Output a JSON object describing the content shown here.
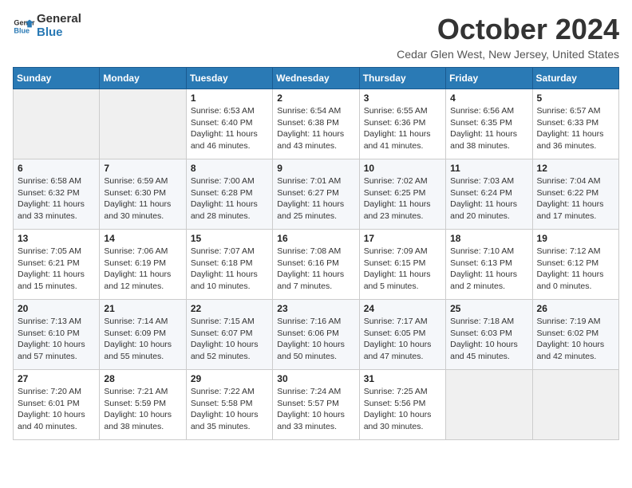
{
  "logo": {
    "line1": "General",
    "line2": "Blue"
  },
  "title": "October 2024",
  "subtitle": "Cedar Glen West, New Jersey, United States",
  "days_header": [
    "Sunday",
    "Monday",
    "Tuesday",
    "Wednesday",
    "Thursday",
    "Friday",
    "Saturday"
  ],
  "weeks": [
    [
      {
        "day": "",
        "info": ""
      },
      {
        "day": "",
        "info": ""
      },
      {
        "day": "1",
        "info": "Sunrise: 6:53 AM\nSunset: 6:40 PM\nDaylight: 11 hours\nand 46 minutes."
      },
      {
        "day": "2",
        "info": "Sunrise: 6:54 AM\nSunset: 6:38 PM\nDaylight: 11 hours\nand 43 minutes."
      },
      {
        "day": "3",
        "info": "Sunrise: 6:55 AM\nSunset: 6:36 PM\nDaylight: 11 hours\nand 41 minutes."
      },
      {
        "day": "4",
        "info": "Sunrise: 6:56 AM\nSunset: 6:35 PM\nDaylight: 11 hours\nand 38 minutes."
      },
      {
        "day": "5",
        "info": "Sunrise: 6:57 AM\nSunset: 6:33 PM\nDaylight: 11 hours\nand 36 minutes."
      }
    ],
    [
      {
        "day": "6",
        "info": "Sunrise: 6:58 AM\nSunset: 6:32 PM\nDaylight: 11 hours\nand 33 minutes."
      },
      {
        "day": "7",
        "info": "Sunrise: 6:59 AM\nSunset: 6:30 PM\nDaylight: 11 hours\nand 30 minutes."
      },
      {
        "day": "8",
        "info": "Sunrise: 7:00 AM\nSunset: 6:28 PM\nDaylight: 11 hours\nand 28 minutes."
      },
      {
        "day": "9",
        "info": "Sunrise: 7:01 AM\nSunset: 6:27 PM\nDaylight: 11 hours\nand 25 minutes."
      },
      {
        "day": "10",
        "info": "Sunrise: 7:02 AM\nSunset: 6:25 PM\nDaylight: 11 hours\nand 23 minutes."
      },
      {
        "day": "11",
        "info": "Sunrise: 7:03 AM\nSunset: 6:24 PM\nDaylight: 11 hours\nand 20 minutes."
      },
      {
        "day": "12",
        "info": "Sunrise: 7:04 AM\nSunset: 6:22 PM\nDaylight: 11 hours\nand 17 minutes."
      }
    ],
    [
      {
        "day": "13",
        "info": "Sunrise: 7:05 AM\nSunset: 6:21 PM\nDaylight: 11 hours\nand 15 minutes."
      },
      {
        "day": "14",
        "info": "Sunrise: 7:06 AM\nSunset: 6:19 PM\nDaylight: 11 hours\nand 12 minutes."
      },
      {
        "day": "15",
        "info": "Sunrise: 7:07 AM\nSunset: 6:18 PM\nDaylight: 11 hours\nand 10 minutes."
      },
      {
        "day": "16",
        "info": "Sunrise: 7:08 AM\nSunset: 6:16 PM\nDaylight: 11 hours\nand 7 minutes."
      },
      {
        "day": "17",
        "info": "Sunrise: 7:09 AM\nSunset: 6:15 PM\nDaylight: 11 hours\nand 5 minutes."
      },
      {
        "day": "18",
        "info": "Sunrise: 7:10 AM\nSunset: 6:13 PM\nDaylight: 11 hours\nand 2 minutes."
      },
      {
        "day": "19",
        "info": "Sunrise: 7:12 AM\nSunset: 6:12 PM\nDaylight: 11 hours\nand 0 minutes."
      }
    ],
    [
      {
        "day": "20",
        "info": "Sunrise: 7:13 AM\nSunset: 6:10 PM\nDaylight: 10 hours\nand 57 minutes."
      },
      {
        "day": "21",
        "info": "Sunrise: 7:14 AM\nSunset: 6:09 PM\nDaylight: 10 hours\nand 55 minutes."
      },
      {
        "day": "22",
        "info": "Sunrise: 7:15 AM\nSunset: 6:07 PM\nDaylight: 10 hours\nand 52 minutes."
      },
      {
        "day": "23",
        "info": "Sunrise: 7:16 AM\nSunset: 6:06 PM\nDaylight: 10 hours\nand 50 minutes."
      },
      {
        "day": "24",
        "info": "Sunrise: 7:17 AM\nSunset: 6:05 PM\nDaylight: 10 hours\nand 47 minutes."
      },
      {
        "day": "25",
        "info": "Sunrise: 7:18 AM\nSunset: 6:03 PM\nDaylight: 10 hours\nand 45 minutes."
      },
      {
        "day": "26",
        "info": "Sunrise: 7:19 AM\nSunset: 6:02 PM\nDaylight: 10 hours\nand 42 minutes."
      }
    ],
    [
      {
        "day": "27",
        "info": "Sunrise: 7:20 AM\nSunset: 6:01 PM\nDaylight: 10 hours\nand 40 minutes."
      },
      {
        "day": "28",
        "info": "Sunrise: 7:21 AM\nSunset: 5:59 PM\nDaylight: 10 hours\nand 38 minutes."
      },
      {
        "day": "29",
        "info": "Sunrise: 7:22 AM\nSunset: 5:58 PM\nDaylight: 10 hours\nand 35 minutes."
      },
      {
        "day": "30",
        "info": "Sunrise: 7:24 AM\nSunset: 5:57 PM\nDaylight: 10 hours\nand 33 minutes."
      },
      {
        "day": "31",
        "info": "Sunrise: 7:25 AM\nSunset: 5:56 PM\nDaylight: 10 hours\nand 30 minutes."
      },
      {
        "day": "",
        "info": ""
      },
      {
        "day": "",
        "info": ""
      }
    ]
  ]
}
